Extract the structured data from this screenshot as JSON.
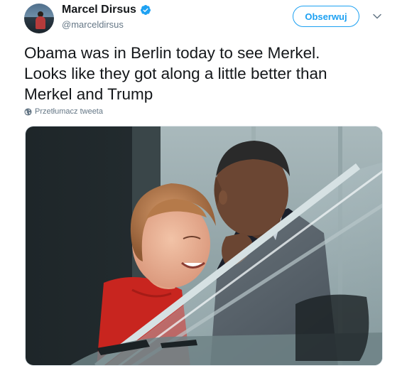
{
  "tweet": {
    "author": {
      "display_name": "Marcel Dirsus",
      "handle": "@marceldirsus",
      "verified": true
    },
    "follow_label": "Obserwuj",
    "text": "Obama was in Berlin today to see Merkel.\nLooks like they got along a little better than\nMerkel and Trump",
    "translate_label": "Przetłumacz tweeta",
    "colors": {
      "accent": "#1da1f2",
      "text": "#14171a",
      "secondary": "#657786"
    },
    "icons": [
      "verified-badge-icon",
      "chevron-down-icon",
      "globe-icon"
    ]
  }
}
